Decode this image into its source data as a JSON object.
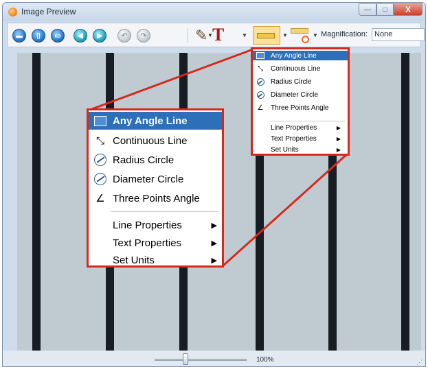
{
  "window": {
    "title": "Image Preview",
    "controls": {
      "minimize": "—",
      "maximize": "□",
      "close": "X"
    }
  },
  "toolbar": {
    "buttons": [
      {
        "name": "save",
        "icon": "save-disk-icon"
      },
      {
        "name": "new",
        "icon": "document-icon"
      },
      {
        "name": "print",
        "icon": "printer-icon"
      },
      {
        "name": "previous",
        "icon": "arrow-left-icon"
      },
      {
        "name": "next",
        "icon": "arrow-right-icon"
      },
      {
        "name": "undo",
        "icon": "undo-icon",
        "enabled": false
      },
      {
        "name": "redo",
        "icon": "redo-icon",
        "enabled": false
      }
    ],
    "draw_tool_icon": "pencil-icon",
    "text_tool_glyph": "T",
    "measure_tool_icon": "ruler-icon",
    "calibrate_tool_icon": "calibrate-ruler-icon",
    "magnification_label": "Magnification:",
    "magnification_value": "None"
  },
  "image_area": {
    "description_color": "#bfcbd1",
    "bar_color": "#171d22"
  },
  "menu_small": {
    "items": [
      {
        "label": "Any Angle Line",
        "icon": "any-angle-line-icon",
        "highlighted": true
      },
      {
        "label": "Continuous Line",
        "icon": "continuous-line-icon"
      },
      {
        "label": "Radius Circle",
        "icon": "radius-circle-icon"
      },
      {
        "label": "Diameter Circle",
        "icon": "diameter-circle-icon"
      },
      {
        "label": "Three Points Angle",
        "icon": "angle-icon"
      }
    ],
    "submenus": [
      {
        "label": "Line Properties"
      },
      {
        "label": "Text Properties"
      },
      {
        "label": "Set Units"
      }
    ]
  },
  "menu_big": {
    "items": [
      {
        "label": "Any Angle Line",
        "icon": "any-angle-line-icon",
        "highlighted": true
      },
      {
        "label": "Continuous Line",
        "icon": "continuous-line-icon"
      },
      {
        "label": "Radius Circle",
        "icon": "radius-circle-icon"
      },
      {
        "label": "Diameter Circle",
        "icon": "diameter-circle-icon"
      },
      {
        "label": "Three Points Angle",
        "icon": "angle-icon"
      }
    ],
    "submenus": [
      {
        "label": "Line Properties"
      },
      {
        "label": "Text Properties"
      },
      {
        "label": "Set Units"
      }
    ]
  },
  "statusbar": {
    "zoom_text": "100%",
    "zoom_level": 100
  },
  "colors": {
    "highlight": "#2d6fb8",
    "callout_border": "#d7281c",
    "window_chrome": "#cfdceb"
  }
}
